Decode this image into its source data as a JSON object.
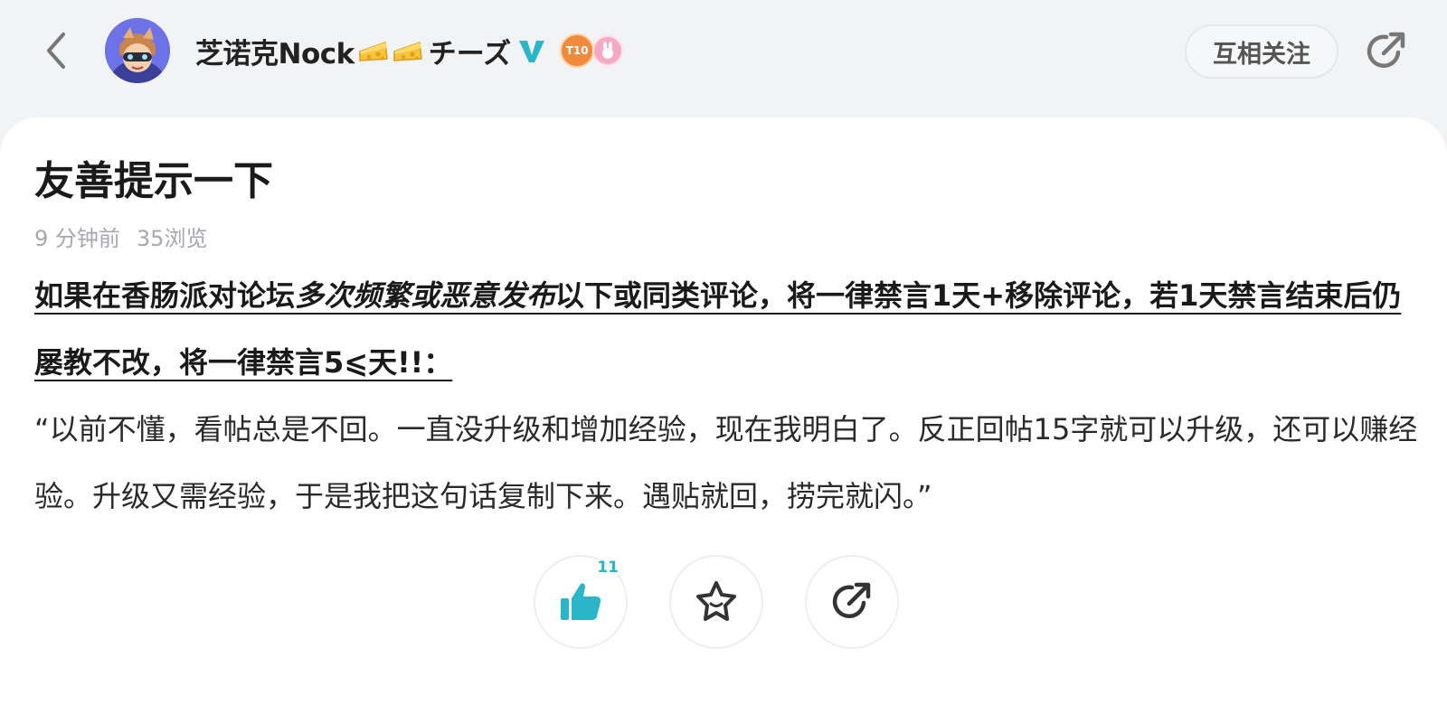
{
  "header": {
    "author_name": "芝诺克Nock",
    "author_suffix": "チーズ",
    "follow_label": "互相关注",
    "level_badge": "T10",
    "colors": {
      "verified": "#2bb5c9",
      "level_badge": "#f08a3c",
      "bunny_badge": "#f6a9c4"
    }
  },
  "post": {
    "title": "友善提示一下",
    "time_ago": "9 分钟前",
    "views": "35浏览",
    "warning_pre": "如果在香肠派对论坛",
    "warning_italic": "多次频繁或恶意发布",
    "warning_post": "以下或同类评论，将一律禁言1天+移除评论，若1天禁言结束后仍屡教不改，将一律禁言5⩽天!!：",
    "quote": "“以前不懂，看帖总是不回。一直没升级和增加经验，现在我明白了。反正回帖15字就可以升级，还可以赚经验。升级又需经验，于是我把这句话复制下来。遇贴就回，捞完就闪。”"
  },
  "actions": {
    "like_count": "11",
    "accent_color": "#2bb5c9"
  }
}
